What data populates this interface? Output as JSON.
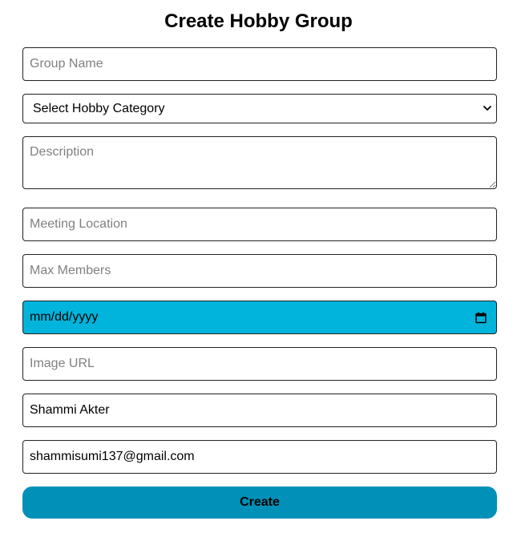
{
  "form": {
    "title": "Create Hobby Group",
    "group_name": {
      "placeholder": "Group Name",
      "value": ""
    },
    "category": {
      "selected": "Select Hobby Category"
    },
    "description": {
      "placeholder": "Description",
      "value": ""
    },
    "meeting_location": {
      "placeholder": "Meeting Location",
      "value": ""
    },
    "max_members": {
      "placeholder": "Max Members",
      "value": ""
    },
    "start_date": {
      "display": "mm/dd/yyyy",
      "icon": "calendar-icon",
      "background": "#00b4dc"
    },
    "image_url": {
      "placeholder": "Image URL",
      "value": ""
    },
    "user_name": {
      "value": "Shammi Akter"
    },
    "user_email": {
      "value": "shammisumi137@gmail.com"
    },
    "submit": {
      "label": "Create",
      "background": "#0090b8"
    }
  }
}
